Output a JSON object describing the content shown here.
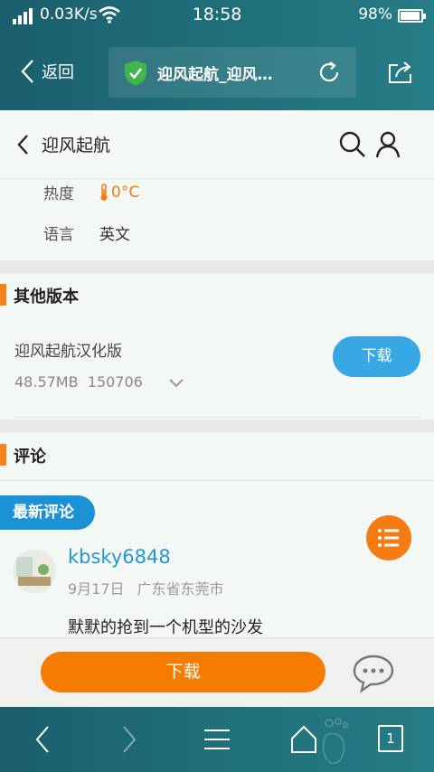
{
  "status_bar": {
    "speed": "0.03K/s",
    "time": "18:58",
    "battery": "98%"
  },
  "browser": {
    "back_label": "返回",
    "url_title": "迎风起航_迎风…",
    "tab_count": "1"
  },
  "header": {
    "title": "迎风起航"
  },
  "info": {
    "heat_label": "热度",
    "heat_value": "0°C",
    "lang_label": "语言",
    "lang_value": "英文"
  },
  "other_versions": {
    "title": "其他版本",
    "item": {
      "name": "迎风起航汉化版",
      "size": "48.57MB",
      "version": "150706",
      "download_label": "下载"
    }
  },
  "comments": {
    "title": "评论",
    "latest_label": "最新评论",
    "items": [
      {
        "user": "kbsky6848",
        "date": "9月17日",
        "location": "广东省东莞市",
        "text": "默默的抢到一个机型的沙发"
      }
    ]
  },
  "action_bar": {
    "download_label": "下载"
  },
  "colors": {
    "teal": "#1f6d78",
    "orange": "#f57c00",
    "blue": "#39a7e3",
    "badge_blue": "#1d91d6",
    "link_blue": "#2596d3"
  },
  "icons": [
    "signal-icon",
    "wifi-icon",
    "battery-icon",
    "back-chevron-icon",
    "shield-check-icon",
    "reload-icon",
    "share-icon",
    "search-icon",
    "user-icon",
    "thermometer-icon",
    "chevron-down-icon",
    "list-icon",
    "chat-icon",
    "nav-back-icon",
    "nav-forward-icon",
    "menu-icon",
    "home-icon"
  ]
}
